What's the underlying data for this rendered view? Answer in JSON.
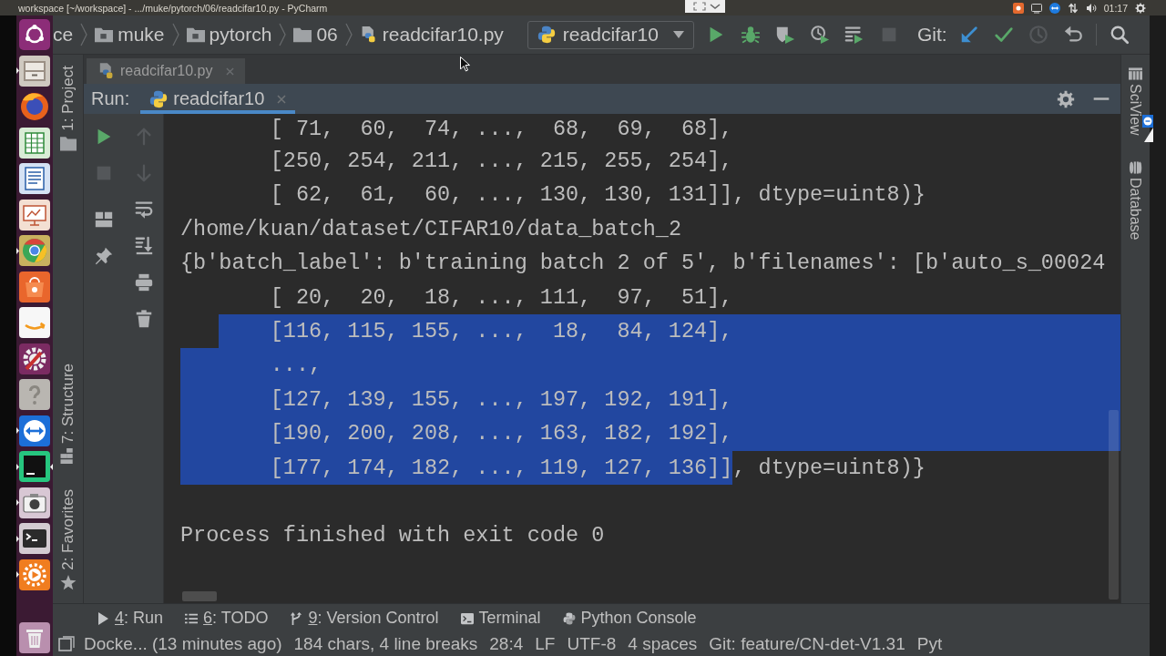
{
  "title_bar": {
    "title": "workspace [~/workspace] - .../muke/pytorch/06/readcifar10.py - PyCharm",
    "clock": "01:17"
  },
  "launcher": [
    {
      "kind": "dash",
      "running": false,
      "focused": false
    },
    {
      "kind": "files",
      "running": true,
      "focused": false
    },
    {
      "kind": "globe",
      "running": false,
      "focused": false
    },
    {
      "kind": "spreadsheet",
      "running": false,
      "focused": false
    },
    {
      "kind": "document",
      "running": false,
      "focused": false
    },
    {
      "kind": "presentation",
      "running": false,
      "focused": false
    },
    {
      "kind": "ring",
      "running": true,
      "focused": false
    },
    {
      "kind": "software",
      "running": false,
      "focused": false
    },
    {
      "kind": "shop",
      "running": false,
      "focused": false
    },
    {
      "kind": "settings",
      "running": false,
      "focused": false
    },
    {
      "kind": "help",
      "running": false,
      "focused": false
    },
    {
      "kind": "remote",
      "running": true,
      "focused": false
    },
    {
      "kind": "ide",
      "running": true,
      "focused": true
    },
    {
      "kind": "camera",
      "running": true,
      "focused": false
    },
    {
      "kind": "terminal",
      "running": true,
      "focused": false
    },
    {
      "kind": "updater",
      "running": true,
      "focused": false
    },
    {
      "kind": "trash",
      "running": false,
      "focused": false
    }
  ],
  "navigation_bar": {
    "breadcrumbs": [
      {
        "label": "ce",
        "kind": "project"
      },
      {
        "label": "muke",
        "kind": "module_folder"
      },
      {
        "label": "pytorch",
        "kind": "module_folder"
      },
      {
        "label": "06",
        "kind": "folder"
      },
      {
        "label": "readcifar10.py",
        "kind": "python_file"
      }
    ],
    "run_configuration": "readcifar10",
    "run_buttons": [
      {
        "kind": "run",
        "disabled": false
      },
      {
        "kind": "debug",
        "disabled": false
      },
      {
        "kind": "coverage",
        "disabled": false
      },
      {
        "kind": "profile",
        "disabled": false
      },
      {
        "kind": "concurrency",
        "disabled": false
      },
      {
        "kind": "stop",
        "disabled": true
      }
    ],
    "git_label": "Git:",
    "git_buttons": [
      {
        "kind": "update",
        "disabled": false
      },
      {
        "kind": "commit",
        "disabled": false
      },
      {
        "kind": "history",
        "disabled": true
      },
      {
        "kind": "rollback",
        "disabled": false
      }
    ]
  },
  "left_tool_windows": {
    "top": [
      {
        "label": "1: Project",
        "kind": "project"
      }
    ],
    "bottom": [
      {
        "label": "7: Structure",
        "kind": "structure"
      },
      {
        "label": "2: Favorites",
        "kind": "favorites"
      }
    ]
  },
  "editor_tabs": [
    {
      "label": "readcifar10.py"
    }
  ],
  "run_panel": {
    "title": "Run:",
    "tabs": [
      {
        "label": "readcifar10",
        "selected": true
      }
    ],
    "toolbar_columns": [
      [
        {
          "kind": "rerun",
          "disabled": false
        },
        {
          "kind": "stop",
          "disabled": true
        },
        {
          "kind": "layout",
          "disabled": false
        },
        {
          "kind": "pin",
          "disabled": false
        }
      ],
      [
        {
          "kind": "up",
          "disabled": true
        },
        {
          "kind": "down",
          "disabled": true
        },
        {
          "kind": "soft_wrap",
          "disabled": false
        },
        {
          "kind": "scroll_to_end",
          "disabled": false
        },
        {
          "kind": "print",
          "disabled": false
        },
        {
          "kind": "clear",
          "disabled": false
        }
      ]
    ]
  },
  "console": {
    "lines": [
      {
        "kind": "row",
        "segments": [
          {
            "text": "[ 71,  60,  74, ...,  68,  69,  68],",
            "selected": false
          }
        ]
      },
      {
        "kind": "row",
        "segments": [
          {
            "text": "[250, 254, 211, ..., 215, 255, 254],",
            "selected": false
          }
        ]
      },
      {
        "kind": "row",
        "segments": [
          {
            "text": "[ 62,  61,  60, ..., 130, 130, 131]], dtype=uint8)}",
            "selected": false
          }
        ]
      },
      {
        "kind": "text",
        "segments": [
          {
            "text": "/home/kuan/dataset/CIFAR10/data_batch_2",
            "selected": false
          }
        ]
      },
      {
        "kind": "text",
        "segments": [
          {
            "text": "{b'batch_label': b'training batch 2 of 5', b'filenames': [b'auto_s_00024",
            "selected": false
          }
        ]
      },
      {
        "kind": "row",
        "segments": [
          {
            "text": "[ 20,  20,  18, ..., 111,  97,  51],",
            "selected": false
          }
        ]
      },
      {
        "kind": "row",
        "segments": [
          {
            "text": "[116, 115, 155, ...,  18,  84, 124],",
            "selected": true
          }
        ]
      },
      {
        "kind": "row",
        "segments": [
          {
            "text": "...,",
            "selected": true
          }
        ]
      },
      {
        "kind": "row",
        "segments": [
          {
            "text": "[127, 139, 155, ..., 197, 192, 191],",
            "selected": true
          }
        ]
      },
      {
        "kind": "row",
        "segments": [
          {
            "text": "[190, 200, 208, ..., 163, 182, 192],",
            "selected": true
          }
        ]
      },
      {
        "kind": "row",
        "segments": [
          {
            "text": "[177, 174, 182, ..., 119, 127, 136]]",
            "selected": true
          },
          {
            "text": ", dtype=uint8)}",
            "selected": false
          }
        ]
      },
      {
        "kind": "blank"
      },
      {
        "kind": "text",
        "segments": [
          {
            "text": "Process finished with exit code 0",
            "selected": false
          }
        ]
      }
    ]
  },
  "right_tool_windows": [
    {
      "label": "SciView",
      "kind": "sciview"
    },
    {
      "label": "Database",
      "kind": "database"
    }
  ],
  "bottom_tool_windows": [
    {
      "mnemonic": "4",
      "label": ": Run",
      "kind": "run"
    },
    {
      "mnemonic": "6",
      "label": ": TODO",
      "kind": "todo"
    },
    {
      "mnemonic": "9",
      "label": ": Version Control",
      "kind": "version_control"
    },
    {
      "label": "Terminal",
      "kind": "terminal"
    },
    {
      "label": "Python Console",
      "kind": "python_console"
    }
  ],
  "status_bar": [
    "Docke... (13 minutes ago)",
    "184 chars, 4 line breaks",
    "28:4",
    "LF",
    "UTF-8",
    "4 spaces",
    "Git: feature/CN-det-V1.31",
    "Pyt"
  ]
}
